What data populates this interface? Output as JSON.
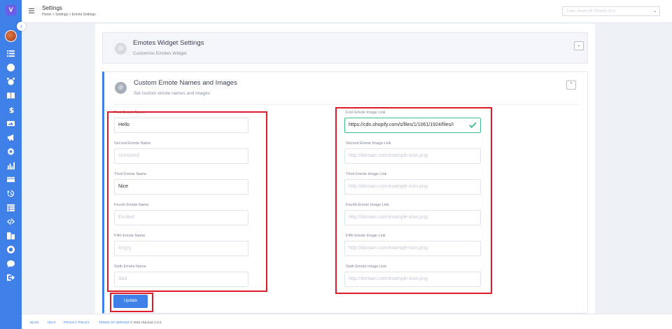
{
  "app": {
    "logo_text": "V"
  },
  "header": {
    "title": "Settings",
    "breadcrumb": "Home > Settings > Emote Settings",
    "select_value": "Lewis Jason Ltd. (Shopify Dev)"
  },
  "sidebar": {
    "icons": [
      "list-icon",
      "clock-icon",
      "alarm-icon",
      "book-icon",
      "dollar-icon",
      "image-icon",
      "megaphone-icon",
      "gear-icon",
      "chart-icon",
      "credit-card-icon",
      "history-icon",
      "table-icon",
      "code-icon",
      "building-icon",
      "support-icon",
      "chat-icon",
      "logout-icon"
    ]
  },
  "widget_settings": {
    "badge": "@",
    "title": "Emotes Widget Settings",
    "subtitle": "Customize Emotes Widget",
    "toggle": "⌄"
  },
  "custom_emotes": {
    "badge": "@",
    "title": "Custom Emote Names and Images",
    "subtitle": "Set custom emote names and images",
    "toggle": "⌃",
    "names": [
      {
        "label": "First Emote Name",
        "value": "Hello",
        "placeholder": ""
      },
      {
        "label": "Second Emote Name",
        "value": "",
        "placeholder": "Unmoved"
      },
      {
        "label": "Third Emote Name",
        "value": "Nice",
        "placeholder": ""
      },
      {
        "label": "Fourth Emote Name",
        "value": "",
        "placeholder": "Excited"
      },
      {
        "label": "Fifth Emote Name",
        "value": "",
        "placeholder": "Angry"
      },
      {
        "label": "Sixth Emote Name",
        "value": "",
        "placeholder": "Sad"
      }
    ],
    "images": [
      {
        "label": "First Emote Image Link",
        "value": "https://cdn.shopify.com/s/files/1/1061/1924/files/I",
        "placeholder": ""
      },
      {
        "label": "Second Emote Image Link",
        "value": "",
        "placeholder": "http://domain.com/example-icon.png"
      },
      {
        "label": "Third Emote Image Link",
        "value": "",
        "placeholder": "http://domain.com/example-icon.png"
      },
      {
        "label": "Fourth Emote Image Link",
        "value": "",
        "placeholder": "http://domain.com/example-icon.png"
      },
      {
        "label": "Fifth Emote Image Link",
        "value": "",
        "placeholder": "http://domain.com/example-icon.png"
      },
      {
        "label": "Sixth Emote Image Link",
        "value": "",
        "placeholder": "http://domain.com/example-icon.png"
      }
    ],
    "update_label": "Update"
  },
  "footer": {
    "links": [
      "BLOG",
      "HELP",
      "PRIVACY POLICY",
      "TERMS OF SERVICE"
    ],
    "copyright": "© 2021 VULKLE 1.0.2"
  },
  "colors": {
    "accent": "#3f7fe8",
    "valid": "#3cbf8a",
    "highlight": "#e01c2b"
  }
}
